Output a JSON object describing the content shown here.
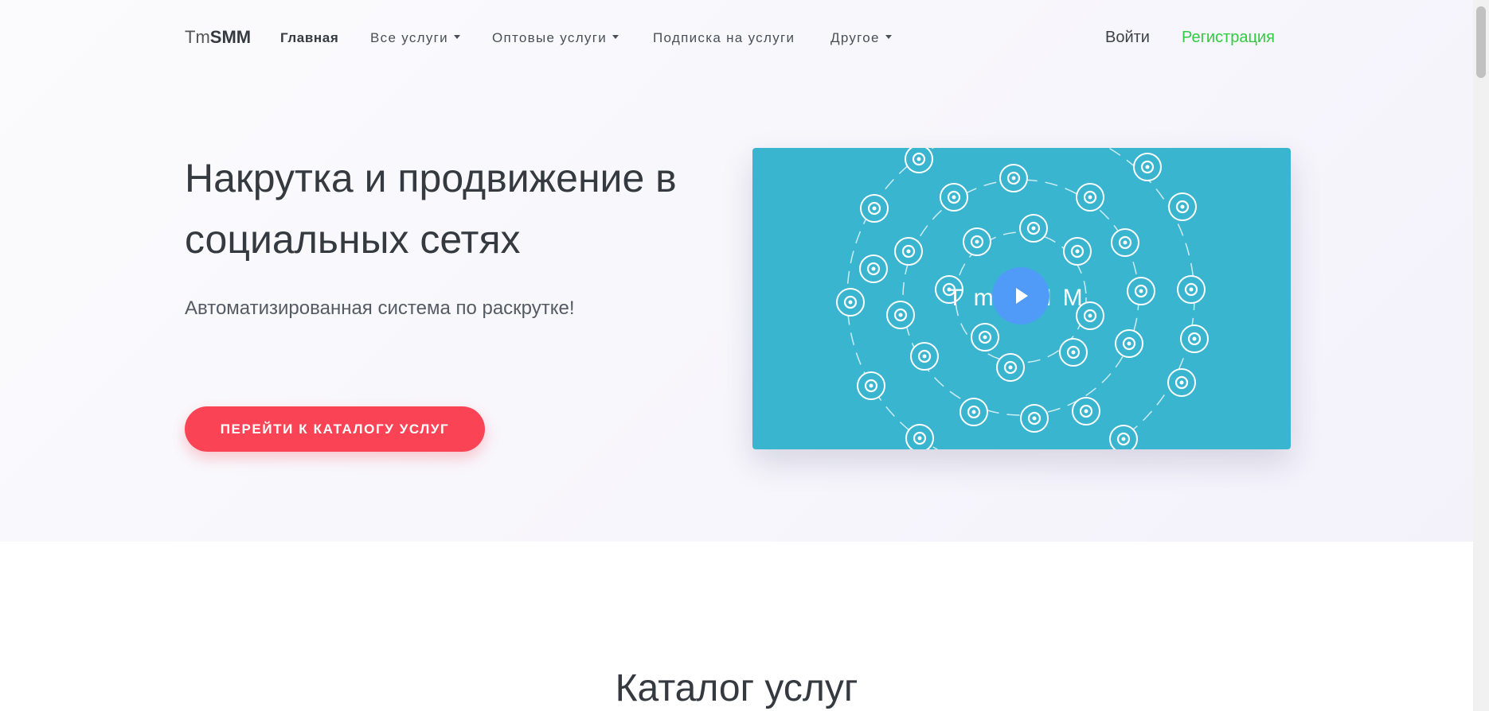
{
  "nav": {
    "brand_light": "Tm",
    "brand_bold": "SMM",
    "items": [
      {
        "label": "Главная",
        "dropdown": false,
        "active": true
      },
      {
        "label": "Все услуги",
        "dropdown": true,
        "active": false
      },
      {
        "label": "Оптовые услуги",
        "dropdown": true,
        "active": false
      },
      {
        "label": "Подписка на услуги",
        "dropdown": false,
        "active": false
      },
      {
        "label": "Другое",
        "dropdown": true,
        "active": false
      }
    ],
    "login": "Войти",
    "register": "Регистрация"
  },
  "hero": {
    "title": "Накрутка и продвижение в социальных сетях",
    "subtitle": "Автоматизированная система по раскрутке!",
    "cta": "ПЕРЕЙТИ К КАТАЛОГУ УСЛУГ"
  },
  "video": {
    "center_text": "TmSMM",
    "icons": [
      "tiktok-icon",
      "heart-icon",
      "snapchat-icon",
      "twitch-icon",
      "vk-icon",
      "flickr-icon",
      "twitch-icon",
      "instagram-icon",
      "steam-icon",
      "vk-icon",
      "dropbox-icon",
      "vine-icon",
      "twitter-icon",
      "viber-icon",
      "vine-icon",
      "skype-icon",
      "facebook-icon",
      "twitch-icon",
      "instagram-icon",
      "vine-icon",
      "vine-icon",
      "share-icon",
      "line-icon",
      "viber-icon",
      "twitch-icon",
      "facebook-icon",
      "vine-icon",
      "telegram-icon",
      "linkedin-icon",
      "periscope-icon",
      "line-icon",
      "vk-icon"
    ]
  },
  "catalog": {
    "title": "Каталог услуг"
  },
  "colors": {
    "accent": "#fa4455",
    "register": "#2ecc40",
    "video_bg": "#3ab5cf",
    "play": "#4f9bf7"
  }
}
